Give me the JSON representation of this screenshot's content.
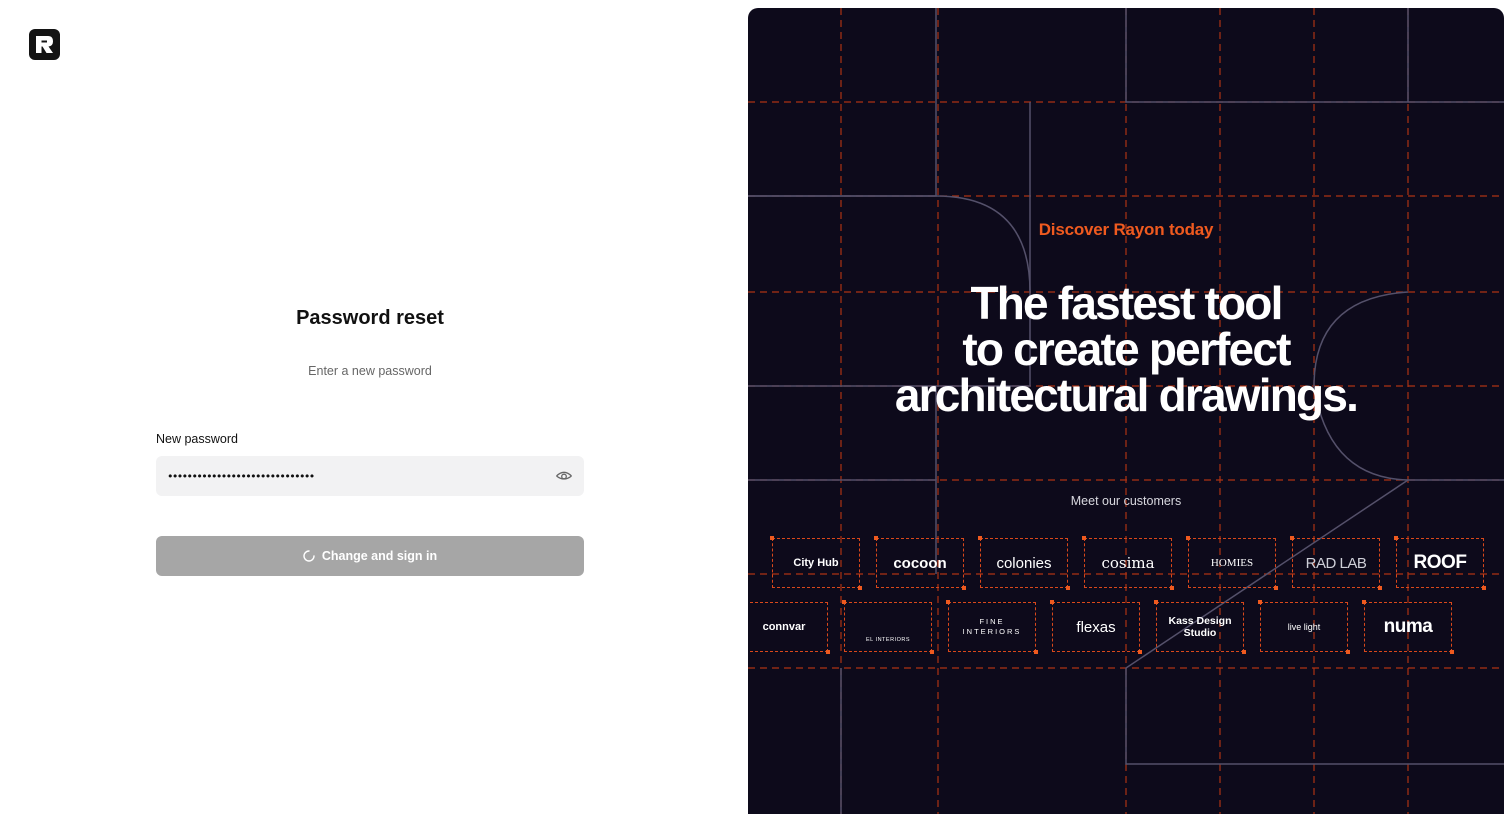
{
  "auth": {
    "title": "Password reset",
    "subtitle": "Enter a new password",
    "password_label": "New password",
    "password_value": "••••••••••••••••••••••••••••••",
    "submit_label": "Change and sign in",
    "submit_state": "loading"
  },
  "promo": {
    "eyebrow": "Discover Rayon today",
    "headline_line1": "The fastest tool",
    "headline_line2": "to create perfect",
    "headline_line3": "architectural drawings.",
    "customers_label": "Meet our customers",
    "row1": [
      "City Hub",
      "cocoon",
      "colonies",
      "cosima",
      "HOMIES",
      "RAD LAB",
      "ROOF"
    ],
    "row2": [
      "connvar",
      "EL INTERIORS",
      "FINE INTERIORS",
      "flexas",
      "Kass Design Studio",
      "live light",
      "numa"
    ]
  },
  "icons": {
    "logo": "rayon-logo-icon",
    "eye": "eye-icon",
    "spinner": "spinner-icon"
  },
  "colors": {
    "accent": "#ef5a1f",
    "panel_bg": "#0d0a1b",
    "button_disabled": "#a6a6a6",
    "input_bg": "#f2f2f3"
  }
}
